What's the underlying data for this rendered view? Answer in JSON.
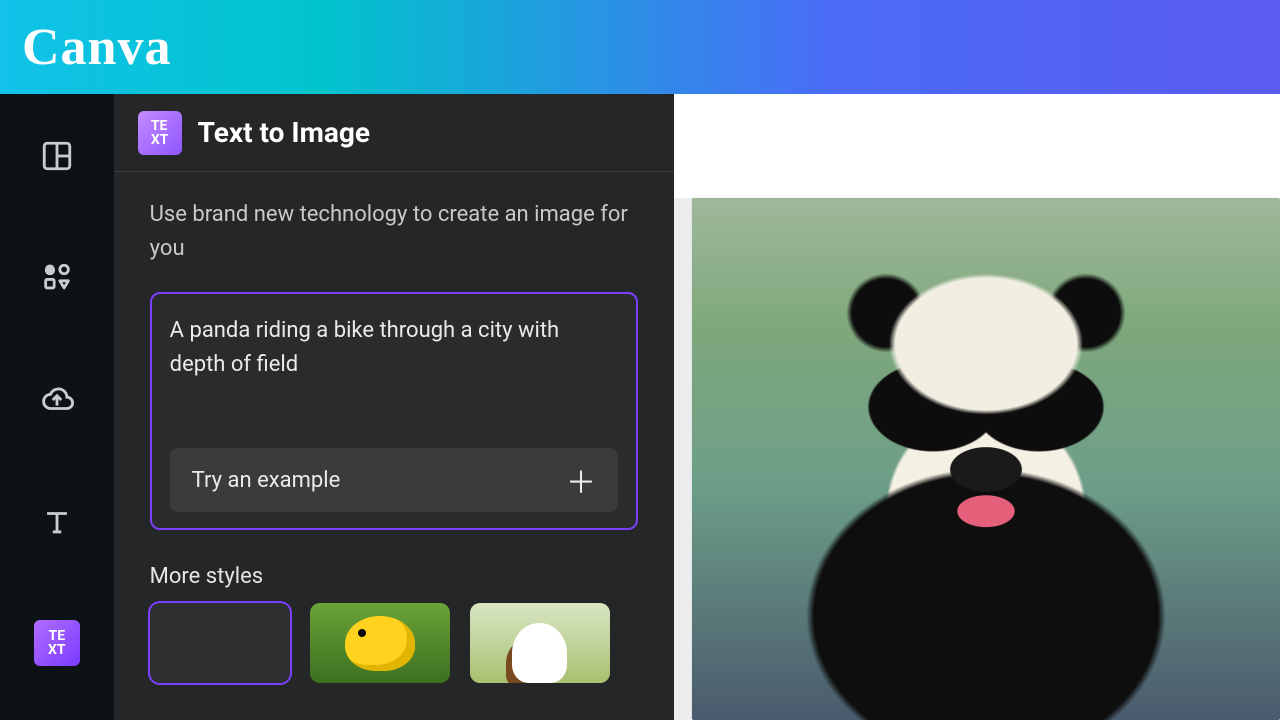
{
  "brand": {
    "name": "Canva"
  },
  "rail": {
    "templates": "templates-icon",
    "elements": "elements-icon",
    "uploads": "uploads-icon",
    "text": "text-icon",
    "app_badge": "TE\nXT"
  },
  "panel": {
    "title": "Text to Image",
    "app_badge": "TE\nXT",
    "description": "Use brand new technology to create an image for you",
    "prompt_value": "A panda riding a bike through a city with depth of field",
    "example_label": "Try an example",
    "more_styles_label": "More styles",
    "styles": [
      {
        "name": "style-none",
        "selected": true
      },
      {
        "name": "style-duck",
        "selected": false
      },
      {
        "name": "style-rabbit",
        "selected": false
      }
    ]
  },
  "canvas": {
    "generated_alt": "Generated image: panda riding a bike through a city with depth of field"
  }
}
